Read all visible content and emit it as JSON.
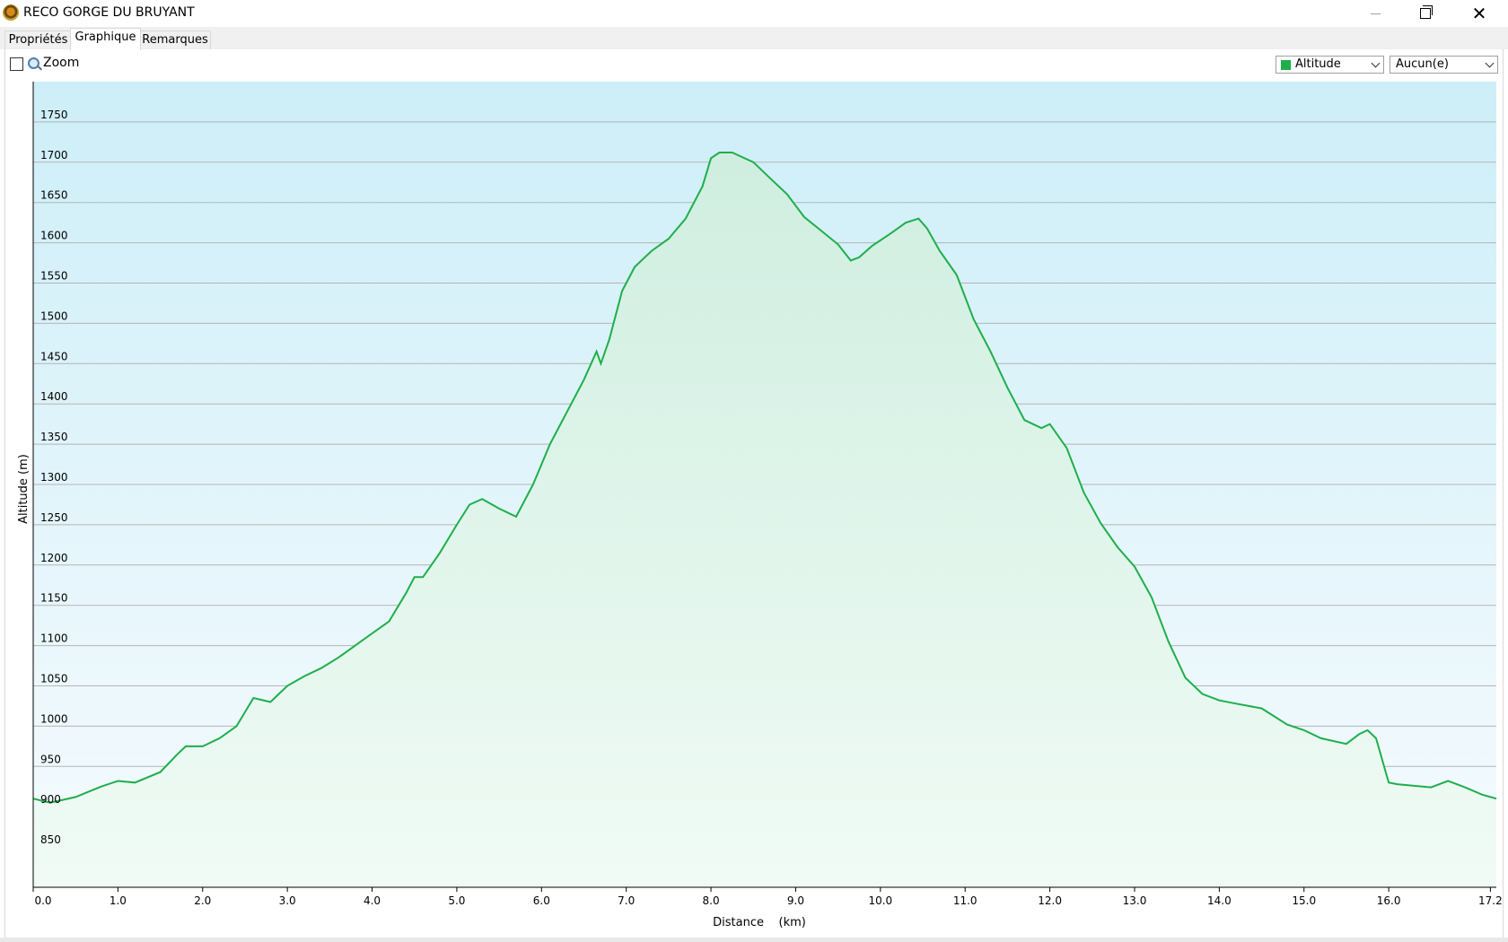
{
  "window": {
    "title": "RECO GORGE DU BRUYANT",
    "close_glyph": "✕"
  },
  "tabs": [
    {
      "label": "Propriétés",
      "active": false
    },
    {
      "label": "Graphique",
      "active": true
    },
    {
      "label": "Remarques",
      "active": false
    }
  ],
  "toolbar": {
    "zoom_label": "Zoom",
    "zoom_checked": false,
    "series_dropdown": {
      "selected": "Altitude",
      "swatch_color": "#1fae4b"
    },
    "second_dropdown": {
      "selected": "Aucun(e)"
    }
  },
  "chart_data": {
    "type": "area",
    "xlabel": "Distance    (km)",
    "ylabel": "Altitude (m)",
    "xlim": [
      0,
      17.27
    ],
    "ylim": [
      800,
      1800
    ],
    "x_ticks": [
      "0.0",
      "1.0",
      "2.0",
      "3.0",
      "4.0",
      "5.0",
      "6.0",
      "7.0",
      "8.0",
      "9.0",
      "10.0",
      "11.0",
      "12.0",
      "13.0",
      "14.0",
      "15.0",
      "16.0",
      "17.2"
    ],
    "x_tick_values": [
      0,
      1,
      2,
      3,
      4,
      5,
      6,
      7,
      8,
      9,
      10,
      11,
      12,
      13,
      14,
      15,
      16,
      17.2
    ],
    "y_ticks": [
      850,
      900,
      950,
      1000,
      1050,
      1100,
      1150,
      1200,
      1250,
      1300,
      1350,
      1400,
      1450,
      1500,
      1550,
      1600,
      1650,
      1700,
      1750
    ],
    "grid": true,
    "line_color": "#1fae4b",
    "x": [
      0,
      0.2,
      0.5,
      0.8,
      1.0,
      1.2,
      1.5,
      1.7,
      1.8,
      2.0,
      2.2,
      2.4,
      2.6,
      2.8,
      2.9,
      3.0,
      3.2,
      3.4,
      3.6,
      3.8,
      4.0,
      4.2,
      4.4,
      4.5,
      4.6,
      4.8,
      5.0,
      5.15,
      5.3,
      5.5,
      5.7,
      5.9,
      6.1,
      6.3,
      6.5,
      6.65,
      6.7,
      6.8,
      6.95,
      7.1,
      7.3,
      7.5,
      7.7,
      7.9,
      8.0,
      8.1,
      8.25,
      8.5,
      8.7,
      8.9,
      9.1,
      9.3,
      9.5,
      9.65,
      9.75,
      9.9,
      10.1,
      10.3,
      10.45,
      10.55,
      10.7,
      10.9,
      11.1,
      11.3,
      11.5,
      11.7,
      11.9,
      12.0,
      12.2,
      12.4,
      12.6,
      12.8,
      13.0,
      13.2,
      13.4,
      13.6,
      13.8,
      14.0,
      14.2,
      14.5,
      14.8,
      15.0,
      15.2,
      15.5,
      15.65,
      15.75,
      15.85,
      16.0,
      16.1,
      16.3,
      16.5,
      16.7,
      16.9,
      17.1,
      17.27
    ],
    "y": [
      910,
      905,
      912,
      925,
      932,
      930,
      943,
      965,
      975,
      975,
      985,
      1000,
      1035,
      1030,
      1040,
      1050,
      1062,
      1072,
      1085,
      1100,
      1115,
      1130,
      1165,
      1185,
      1185,
      1215,
      1250,
      1275,
      1282,
      1270,
      1260,
      1300,
      1350,
      1390,
      1430,
      1465,
      1450,
      1480,
      1540,
      1570,
      1590,
      1605,
      1630,
      1670,
      1705,
      1712,
      1712,
      1700,
      1680,
      1660,
      1632,
      1615,
      1598,
      1578,
      1582,
      1596,
      1610,
      1625,
      1630,
      1618,
      1590,
      1560,
      1505,
      1465,
      1420,
      1380,
      1370,
      1375,
      1345,
      1290,
      1252,
      1222,
      1198,
      1160,
      1105,
      1060,
      1040,
      1032,
      1028,
      1022,
      1002,
      995,
      985,
      978,
      990,
      995,
      985,
      930,
      928,
      926,
      924,
      932,
      924,
      915,
      910
    ]
  }
}
